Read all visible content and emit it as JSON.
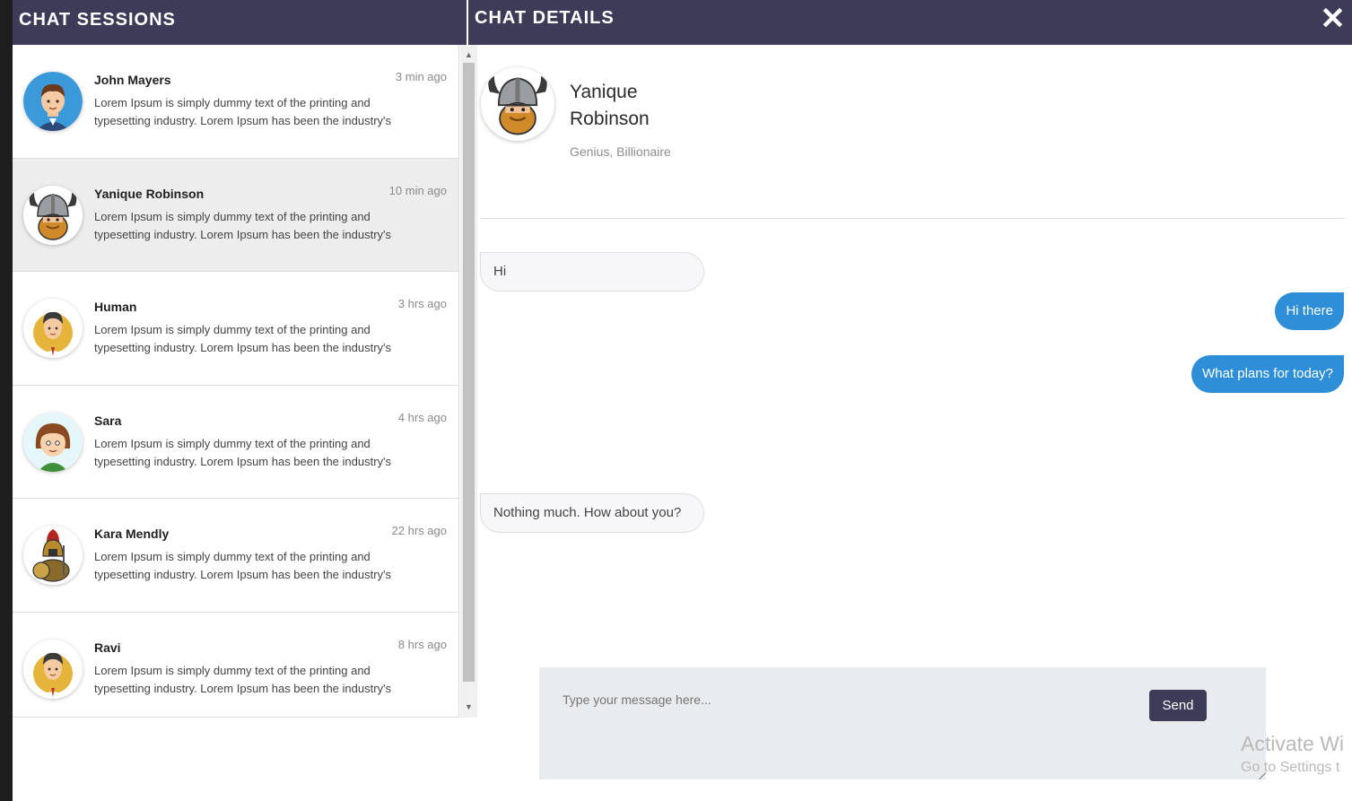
{
  "sessions": {
    "title": "CHAT SESSIONS",
    "items": [
      {
        "name": "John Mayers",
        "time": "3 min ago",
        "preview": "Lorem Ipsum is simply dummy text of the printing and typesetting industry. Lorem Ipsum has been the industry's",
        "avatar": "man-blue-avatar",
        "active": false
      },
      {
        "name": "Yanique Robinson",
        "time": "10 min ago",
        "preview": "Lorem Ipsum is simply dummy text of the printing and typesetting industry. Lorem Ipsum has been the industry's",
        "avatar": "viking-avatar",
        "active": true
      },
      {
        "name": "Human",
        "time": "3 hrs ago",
        "preview": "Lorem Ipsum is simply dummy text of the printing and typesetting industry. Lorem Ipsum has been the industry's",
        "avatar": "man-yellow-avatar",
        "active": false
      },
      {
        "name": "Sara",
        "time": "4 hrs ago",
        "preview": "Lorem Ipsum is simply dummy text of the printing and typesetting industry. Lorem Ipsum has been the industry's",
        "avatar": "woman-avatar",
        "active": false
      },
      {
        "name": "Kara Mendly",
        "time": "22 hrs ago",
        "preview": "Lorem Ipsum is simply dummy text of the printing and typesetting industry. Lorem Ipsum has been the industry's",
        "avatar": "spartan-avatar",
        "active": false
      },
      {
        "name": "Ravi",
        "time": "8 hrs ago",
        "preview": "Lorem Ipsum is simply dummy text of the printing and typesetting industry. Lorem Ipsum has been the industry's",
        "avatar": "man-yellow-avatar",
        "active": false
      }
    ]
  },
  "details": {
    "title": "CHAT DETAILS",
    "close_icon": "close-icon",
    "profile": {
      "name": "Yanique Robinson",
      "role": "Genius, Billionaire",
      "avatar": "viking-avatar"
    },
    "messages": [
      {
        "direction": "in",
        "text": "Hi"
      },
      {
        "direction": "out",
        "text": "Hi there"
      },
      {
        "direction": "out",
        "text": "What plans for today?"
      },
      {
        "direction": "in",
        "text": "Nothing much. How about you?"
      }
    ],
    "composer": {
      "placeholder": "Type your message here...",
      "send_label": "Send"
    }
  },
  "watermark": {
    "line1": "Activate Wi",
    "line2": "Go to Settings t"
  },
  "colors": {
    "header_bg": "#3d3b58",
    "outgoing_bubble": "#2e8fd8",
    "active_row": "#ededed"
  }
}
